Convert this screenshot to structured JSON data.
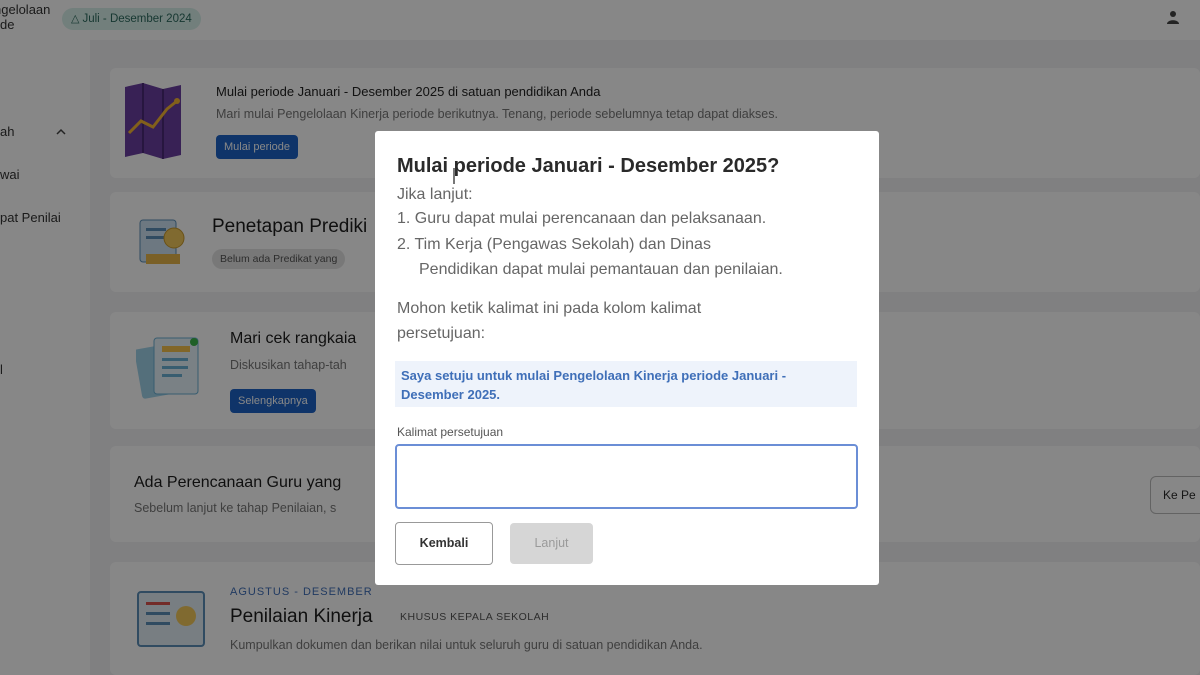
{
  "topbar": {
    "brand_line1": "ngelolaan",
    "brand_line2": "de",
    "period_chip": "Juli - Desember 2024",
    "period_icon": "triangle-icon",
    "user_icon": "user-icon"
  },
  "sidebar": {
    "items": [
      {
        "label": "ah"
      },
      {
        "label": "wai"
      },
      {
        "label": "pat Penilai"
      },
      {
        "label": "l"
      }
    ],
    "chevron_icon": "chevron-up-icon"
  },
  "content": {
    "card1": {
      "title": "Mulai periode Januari - Desember 2025 di satuan pendidikan Anda",
      "desc": "Mari mulai Pengelolaan Kinerja periode berikutnya. Tenang, periode sebelumnya tetap dapat diakses.",
      "button": "Mulai periode"
    },
    "card2": {
      "title": "Penetapan Prediki",
      "tag": "Belum ada Predikat yang"
    },
    "card3": {
      "title": "Mari cek rangkaia",
      "desc": "Diskusikan tahap-tah",
      "button": "Selengkapnya"
    },
    "card4": {
      "title": "Ada Perencanaan Guru yang",
      "desc": "Sebelum lanjut ke tahap Penilaian, s",
      "button": "Ke Pe"
    },
    "card5": {
      "eyebrow": "AGUSTUS - DESEMBER",
      "title": "Penilaian Kinerja",
      "badge": "KHUSUS KEPALA SEKOLAH",
      "desc": "Kumpulkan dokumen dan berikan nilai untuk seluruh guru di satuan pendidikan Anda."
    }
  },
  "modal": {
    "title": "Mulai periode Januari - Desember 2025?",
    "intro": "Jika lanjut:",
    "point1": "1. Guru dapat mulai perencanaan dan pelaksanaan.",
    "point2_line1": "2. Tim Kerja (Pengawas Sekolah) dan Dinas",
    "point2_line2": "Pendidikan dapat mulai pemantauan dan penilaian.",
    "instruction_line1": "Mohon ketik kalimat ini pada kolom kalimat",
    "instruction_line2": "persetujuan:",
    "quote": "Saya setuju untuk mulai Pengelolaan Kinerja periode Januari - Desember 2025.",
    "input_label": "Kalimat persetujuan",
    "input_value": "",
    "back_button": "Kembali",
    "next_button": "Lanjut"
  }
}
